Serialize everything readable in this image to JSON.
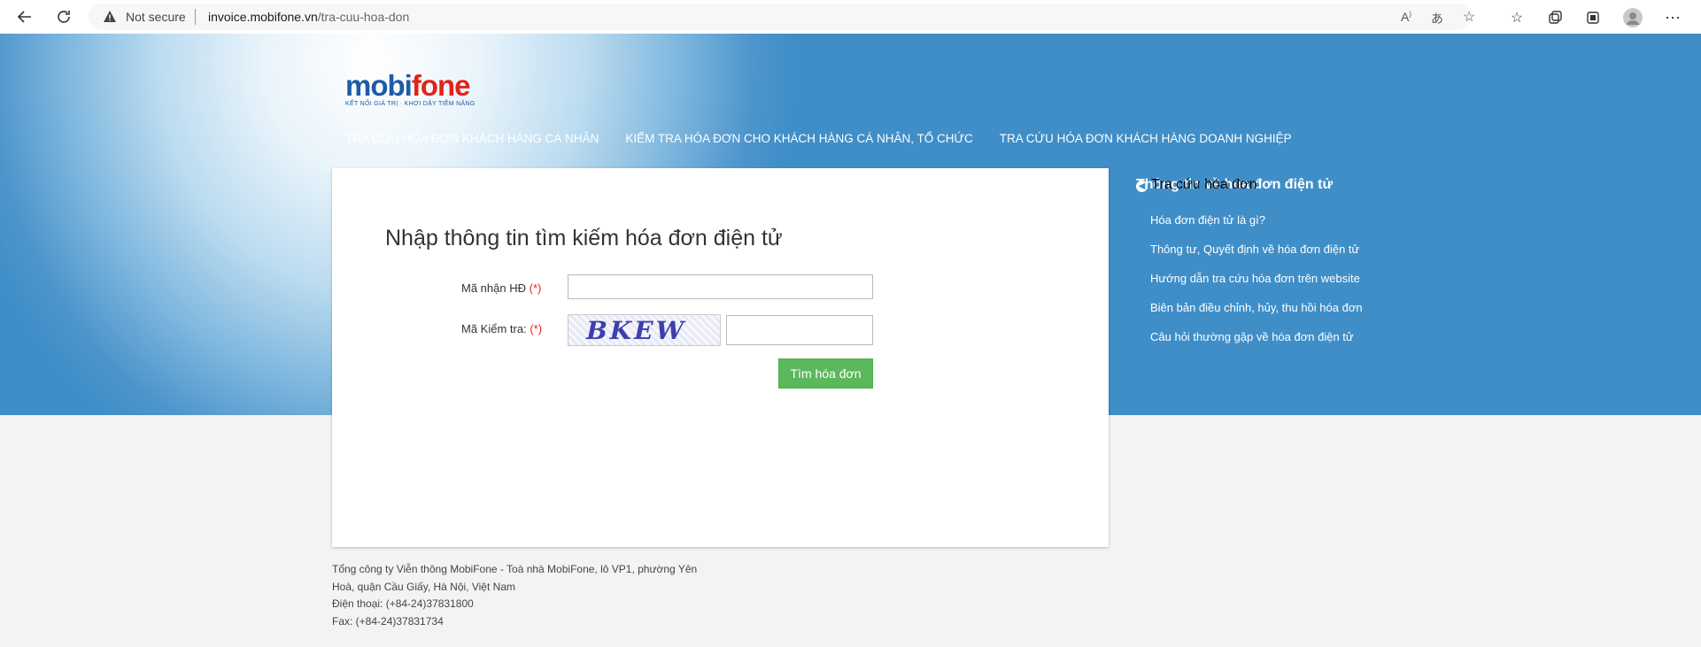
{
  "browser": {
    "security_label": "Not secure",
    "url_domain": "invoice.mobifone.vn",
    "url_path": "/tra-cuu-hoa-don"
  },
  "logo": {
    "part1": "mobi",
    "part2": "fone",
    "tagline": "KẾT NỐI GIÁ TRỊ  ·  KHƠI DẬY TIỀM NĂNG"
  },
  "nav": [
    "TRA CỨU HÓA ĐƠN KHÁCH HÀNG CÁ NHÂN",
    "KIỂM TRA HÓA ĐƠN CHO KHÁCH HÀNG CÁ NHÂN, TỔ CHỨC",
    "TRA CỨU HÓA ĐƠN KHÁCH HÀNG DOANH NGHIỆP"
  ],
  "form": {
    "title": "Nhập thông tin tìm kiếm hóa đơn điện tử",
    "code_label": "Mã nhận HĐ",
    "check_label": "Mã Kiểm tra:",
    "required_mark": "(*)",
    "captcha_text": "BKEW",
    "code_value": "",
    "check_value": "",
    "submit_label": "Tìm hóa đơn"
  },
  "sidebar": {
    "title": "Thông tin về hóa đơn điện tử",
    "items": [
      "Hóa đơn điện tử là gì?",
      "Thông tư, Quyết định về hóa đơn điện tử",
      "Hướng dẫn tra cứu hóa đơn trên website",
      "Biên bản điều chỉnh, hủy, thu hồi hóa đơn",
      "Câu hỏi thường gặp về hóa đơn điện tử"
    ],
    "lookup_link": "Tra cứu hóa đơn"
  },
  "footer": {
    "address": "Tổng công ty Viễn thông MobiFone - Toà nhà MobiFone, lô VP1, phường Yên Hoà, quận Cầu Giấy, Hà Nội, Việt Nam",
    "phone": "Điện thoại: (+84-24)37831800",
    "fax": "Fax: (+84-24)37831734"
  },
  "colors": {
    "brand_blue": "#1e5aa8",
    "brand_red": "#e2231a",
    "hero_blue": "#3f8ec8",
    "button_green": "#5cb85c"
  }
}
